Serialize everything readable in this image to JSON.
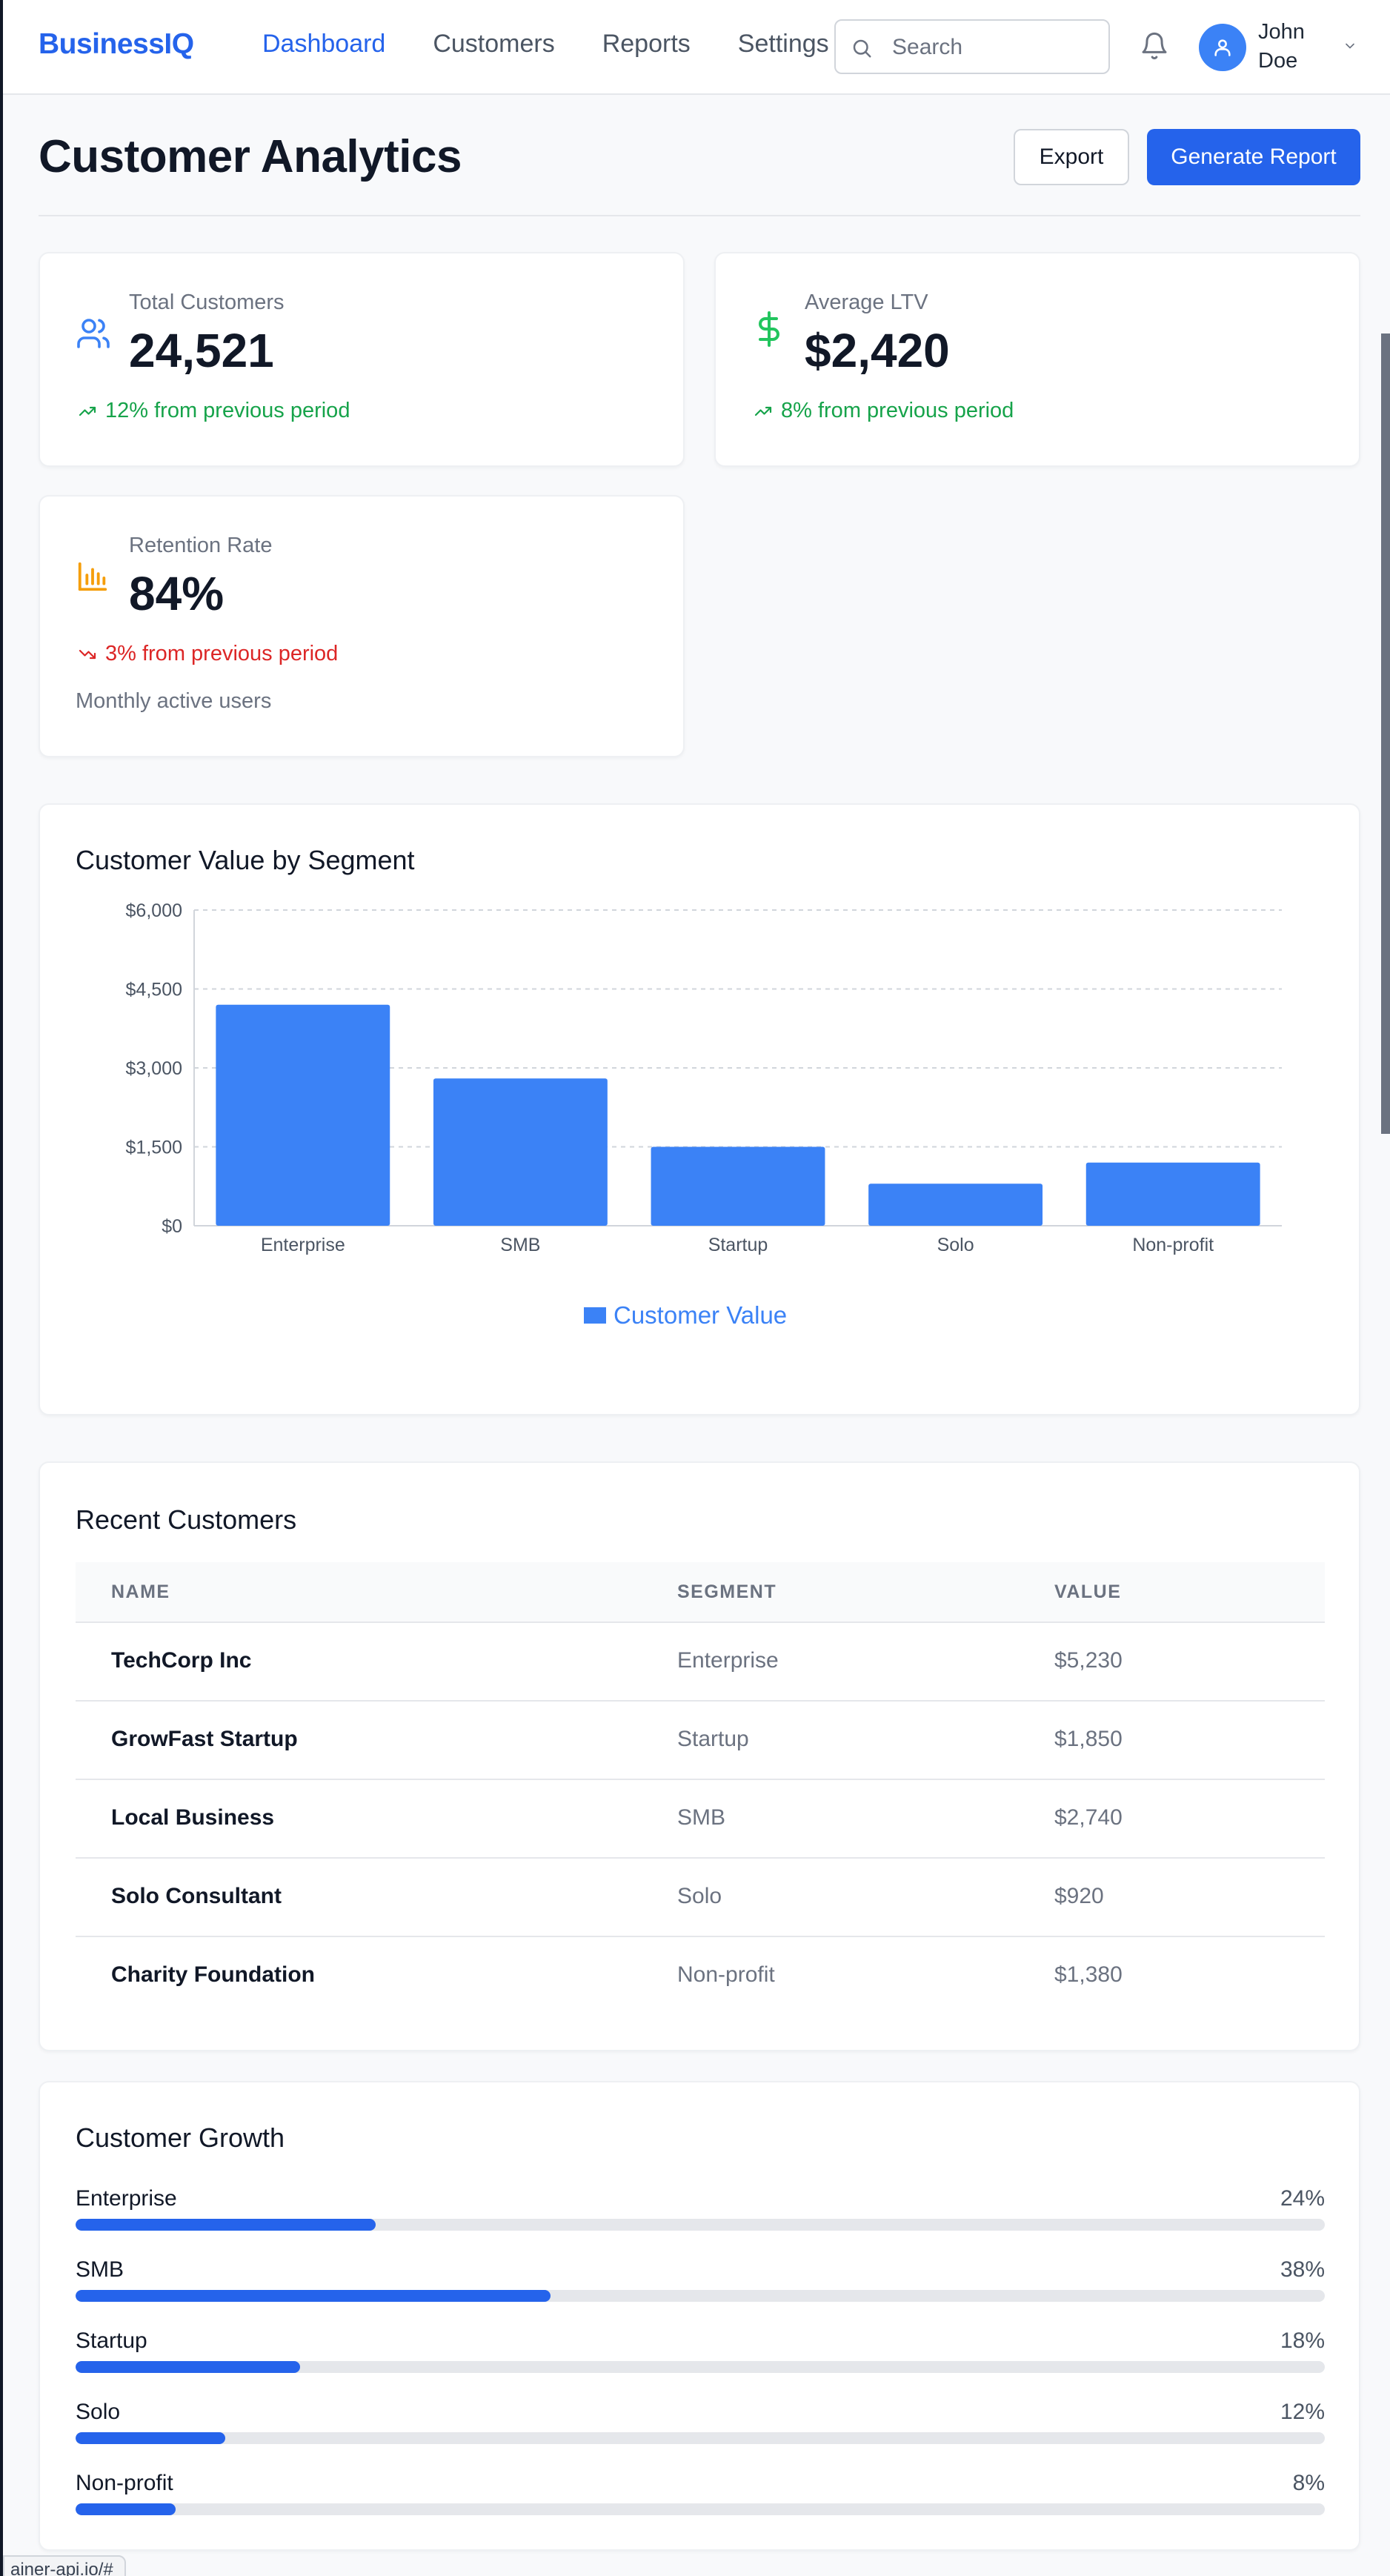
{
  "header": {
    "brand": "BusinessIQ",
    "nav": [
      {
        "label": "Dashboard",
        "active": true
      },
      {
        "label": "Customers",
        "active": false
      },
      {
        "label": "Reports",
        "active": false
      },
      {
        "label": "Settings",
        "active": false
      }
    ],
    "search_placeholder": "Search",
    "user_name": "John Doe"
  },
  "page": {
    "title": "Customer Analytics",
    "export_label": "Export",
    "generate_label": "Generate Report"
  },
  "stats": [
    {
      "label": "Total Customers",
      "value": "24,521",
      "change": "12% from previous period",
      "direction": "up",
      "icon": "users-icon",
      "color": "#3b82f6"
    },
    {
      "label": "Average LTV",
      "value": "$2,420",
      "change": "8% from previous period",
      "direction": "up",
      "icon": "dollar-icon",
      "color": "#22c55e"
    },
    {
      "label": "Retention Rate",
      "value": "84%",
      "change": "3% from previous period",
      "direction": "down",
      "icon": "bar-chart-icon",
      "color": "#f59e0b",
      "note": "Monthly active users"
    }
  ],
  "chart_section": {
    "title": "Customer Value by Segment"
  },
  "chart_data": {
    "type": "bar",
    "title": "Customer Value by Segment",
    "categories": [
      "Enterprise",
      "SMB",
      "Startup",
      "Solo",
      "Non-profit"
    ],
    "series": [
      {
        "name": "Customer Value",
        "values": [
          4200,
          2800,
          1500,
          800,
          1200
        ]
      }
    ],
    "yticks": [
      "$0",
      "$1,500",
      "$3,000",
      "$4,500",
      "$6,000"
    ],
    "ylim": [
      0,
      6000
    ],
    "grid": true,
    "legend": "bottom-center",
    "bar_color": "#3b82f6"
  },
  "customers": {
    "title": "Recent Customers",
    "columns": [
      "NAME",
      "SEGMENT",
      "VALUE"
    ],
    "rows": [
      {
        "name": "TechCorp Inc",
        "segment": "Enterprise",
        "value": "$5,230"
      },
      {
        "name": "GrowFast Startup",
        "segment": "Startup",
        "value": "$1,850"
      },
      {
        "name": "Local Business",
        "segment": "SMB",
        "value": "$2,740"
      },
      {
        "name": "Solo Consultant",
        "segment": "Solo",
        "value": "$920"
      },
      {
        "name": "Charity Foundation",
        "segment": "Non-profit",
        "value": "$1,380"
      }
    ]
  },
  "growth": {
    "title": "Customer Growth",
    "items": [
      {
        "label": "Enterprise",
        "percent": 24,
        "percent_text": "24%"
      },
      {
        "label": "SMB",
        "percent": 38,
        "percent_text": "38%"
      },
      {
        "label": "Startup",
        "percent": 18,
        "percent_text": "18%"
      },
      {
        "label": "Solo",
        "percent": 12,
        "percent_text": "12%"
      },
      {
        "label": "Non-profit",
        "percent": 8,
        "percent_text": "8%"
      }
    ]
  },
  "statusbar_text": "ainer-api.io/#"
}
